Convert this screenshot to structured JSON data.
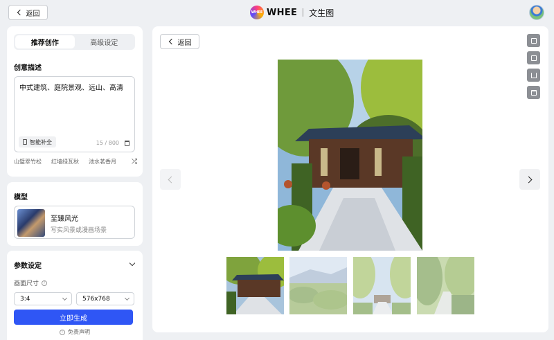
{
  "topbar": {
    "back_label": "返回",
    "brand": "WHEE",
    "brand_badge": "WHEE",
    "page_name": "文生图"
  },
  "left": {
    "tabs": [
      {
        "label": "推荐创作",
        "active": true
      },
      {
        "label": "高级设定",
        "active": false
      }
    ],
    "prompt": {
      "title": "创意描述",
      "text": "中式建筑、庭院景观、远山、高清",
      "smart_fill_label": "智能补全",
      "counter": "15 / 800",
      "suggestions": [
        "山璧翠竹松",
        "红墙绿瓦秋",
        "池水茗香月"
      ]
    },
    "model": {
      "title": "模型",
      "name": "至臻风光",
      "description": "写实风景或漫画场景"
    },
    "params": {
      "title": "参数设定",
      "size_label": "画面尺寸",
      "ratio": "3:4",
      "resolution": "576x768",
      "generate_label": "立即生成",
      "disclaimer": "免责声明"
    }
  },
  "main": {
    "back_label": "返回",
    "tools": [
      "open-external-icon",
      "copy-image-icon",
      "download-icon",
      "delete-icon"
    ],
    "selected_index": 0,
    "thumbnail_count": 4
  },
  "colors": {
    "primary": "#2f56f5",
    "background": "#eef0f3"
  }
}
